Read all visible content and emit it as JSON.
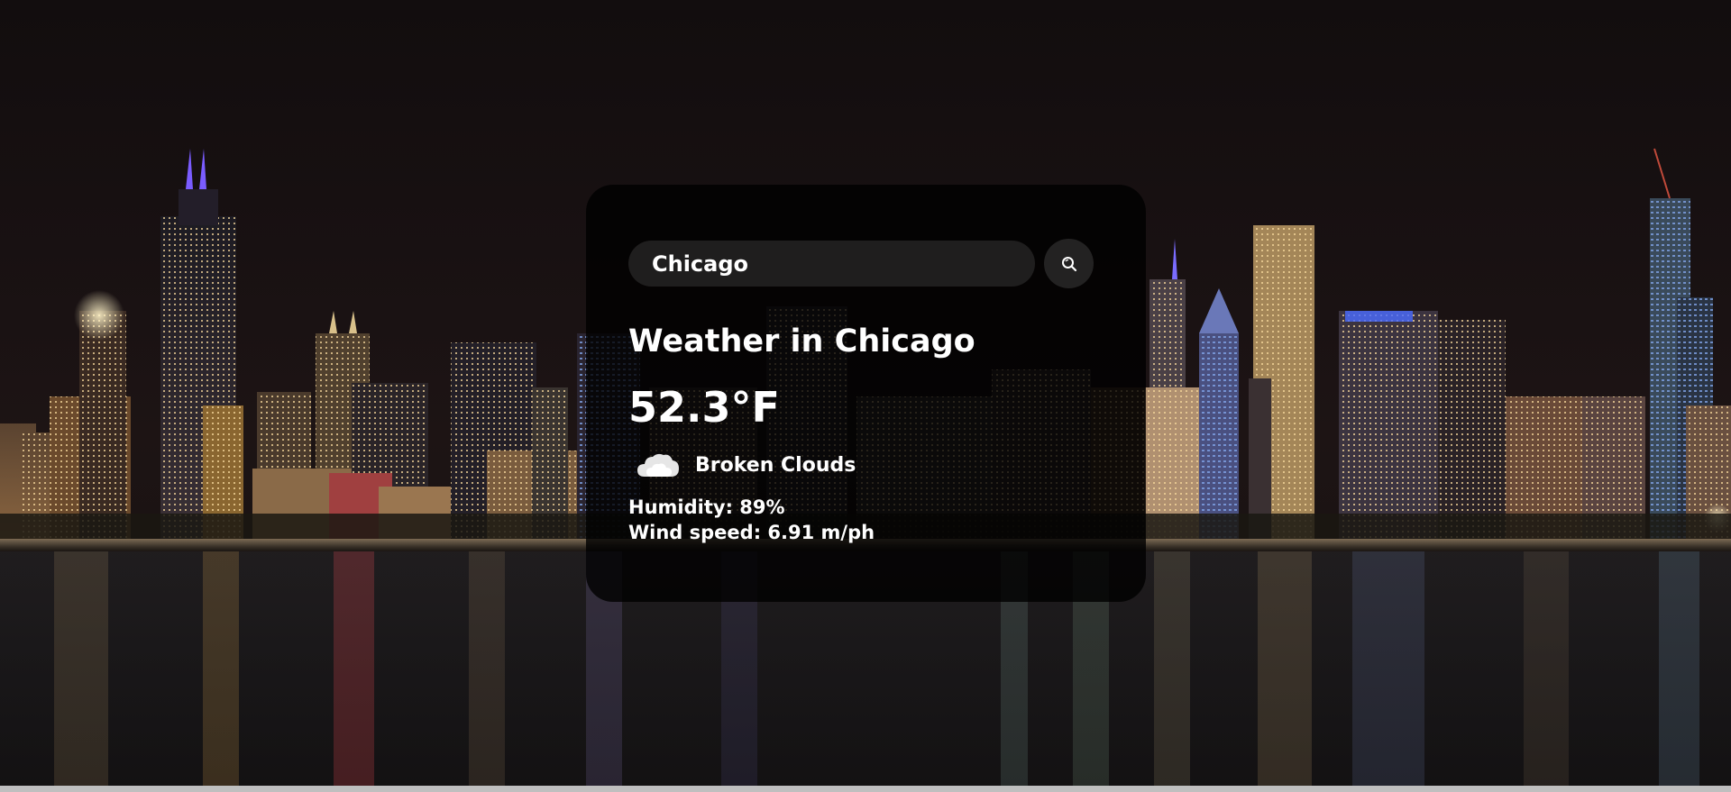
{
  "search": {
    "value": "Chicago",
    "button_icon": "search-icon"
  },
  "weather": {
    "title": "Weather in Chicago",
    "temperature": "52.3°F",
    "icon": "broken-clouds-icon",
    "description": "Broken Clouds",
    "humidity": "Humidity: 89%",
    "wind": "Wind speed: 6.91 m/ph"
  },
  "colors": {
    "card_bg": "rgba(0,0,0,0.80)",
    "text": "#ffffff"
  }
}
